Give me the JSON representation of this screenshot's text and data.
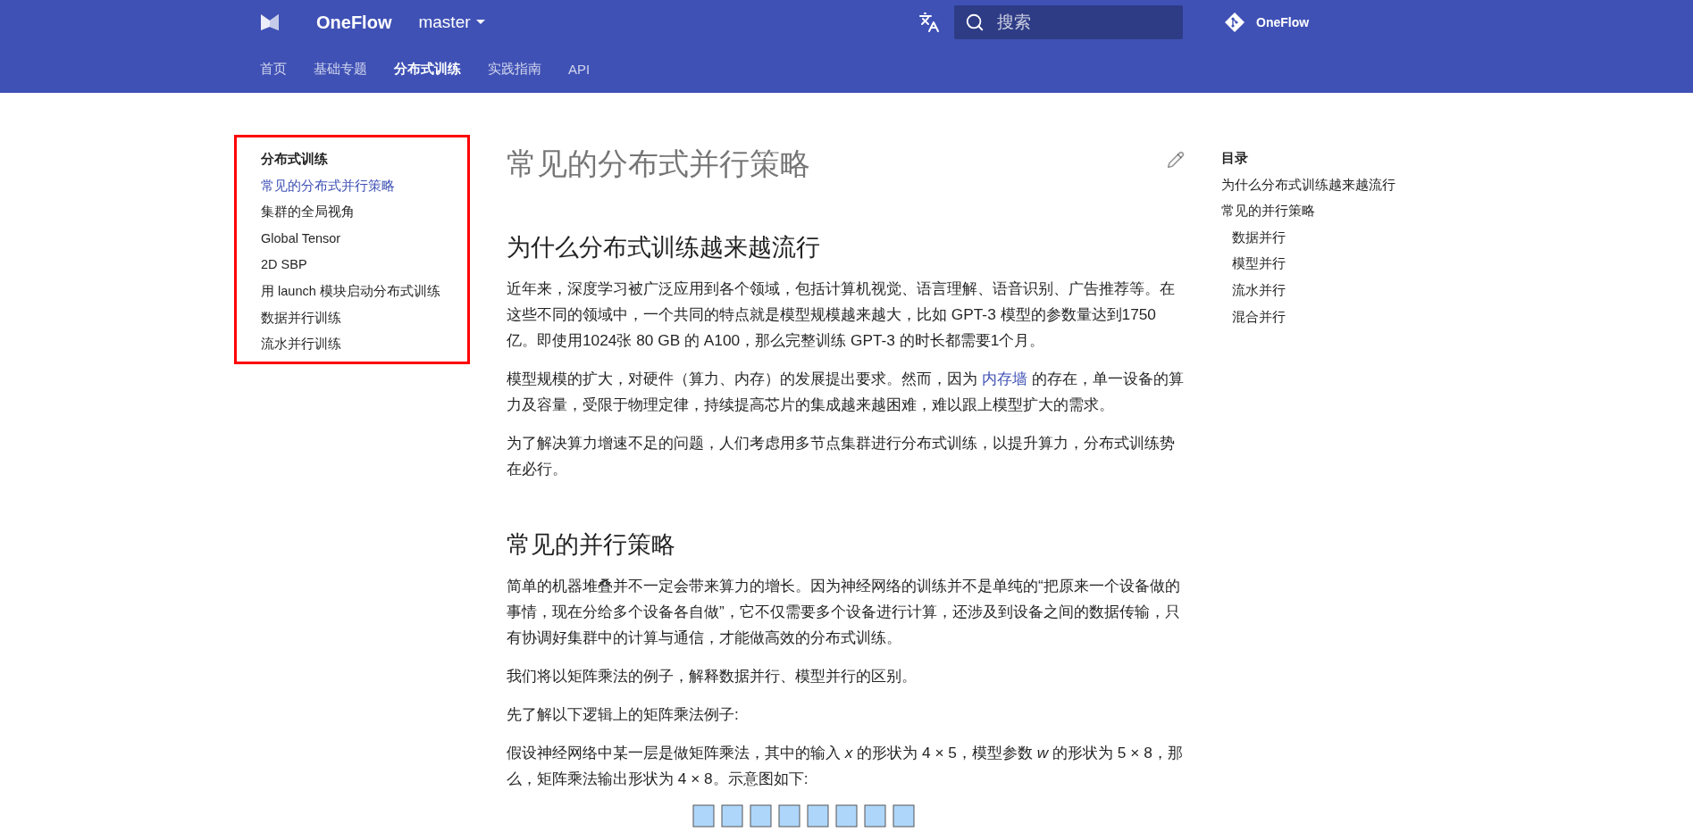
{
  "header": {
    "brand": "OneFlow",
    "version": "master",
    "search": {
      "placeholder": "搜索"
    },
    "repo": "OneFlow"
  },
  "tabs": [
    {
      "label": "首页",
      "selected": false
    },
    {
      "label": "基础专题",
      "selected": false
    },
    {
      "label": "分布式训练",
      "selected": true
    },
    {
      "label": "实践指南",
      "selected": false
    },
    {
      "label": "API",
      "selected": false
    }
  ],
  "sidebar": {
    "title": "分布式训练",
    "highlighted": true,
    "items": [
      {
        "label": "常见的分布式并行策略",
        "selected": true
      },
      {
        "label": "集群的全局视角",
        "selected": false
      },
      {
        "label": "Global Tensor",
        "selected": false
      },
      {
        "label": "2D SBP",
        "selected": false
      },
      {
        "label": "用 launch 模块启动分布式训练",
        "selected": false
      },
      {
        "label": "数据并行训练",
        "selected": false
      },
      {
        "label": "流水并行训练",
        "selected": false
      }
    ]
  },
  "article": {
    "title": "常见的分布式并行策略",
    "blocks": [
      {
        "kind": "heading",
        "text": "为什么分布式训练越来越流行"
      },
      {
        "kind": "paragraph",
        "parts": [
          {
            "kind": "text",
            "text": "近年来，深度学习被广泛应用到各个领域，包括计算机视觉、语言理解、语音识别、广告推荐等。在这些不同的领域中，一个共同的特点就是模型规模越来越大，比如 GPT-3 模型的参数量达到1750亿。即使用1024张 80 GB 的 A100，那么完整训练 GPT-3 的时长都需要1个月。"
          }
        ]
      },
      {
        "kind": "paragraph",
        "parts": [
          {
            "kind": "text",
            "text": "模型规模的扩大，对硬件（算力、内存）的发展提出要求。然而，因为 "
          },
          {
            "kind": "link",
            "text": "内存墙"
          },
          {
            "kind": "text",
            "text": " 的存在，单一设备的算力及容量，受限于物理定律，持续提高芯片的集成越来越困难，难以跟上模型扩大的需求。"
          }
        ]
      },
      {
        "kind": "paragraph",
        "parts": [
          {
            "kind": "text",
            "text": "为了解决算力增速不足的问题，人们考虑用多节点集群进行分布式训练，以提升算力，分布式训练势在必行。"
          }
        ]
      },
      {
        "kind": "heading",
        "text": "常见的并行策略"
      },
      {
        "kind": "paragraph",
        "parts": [
          {
            "kind": "text",
            "text": "简单的机器堆叠并不一定会带来算力的增长。因为神经网络的训练并不是单纯的“把原来一个设备做的事情，现在分给多个设备各自做”，它不仅需要多个设备进行计算，还涉及到设备之间的数据传输，只有协调好集群中的计算与通信，才能做高效的分布式训练。"
          }
        ]
      },
      {
        "kind": "paragraph",
        "parts": [
          {
            "kind": "text",
            "text": "我们将以矩阵乘法的例子，解释数据并行、模型并行的区别。"
          }
        ]
      },
      {
        "kind": "paragraph",
        "parts": [
          {
            "kind": "text",
            "text": "先了解以下逻辑上的矩阵乘法例子:"
          }
        ]
      },
      {
        "kind": "paragraph",
        "parts": [
          {
            "kind": "text",
            "text": "假设神经网络中某一层是做矩阵乘法，其中的输入 *x* 的形状为 4 × 5，模型参数 *w* 的形状为 5 × 8，那么，矩阵乘法输出形状为 4 × 8。示意图如下:"
          }
        ]
      },
      {
        "kind": "figure"
      }
    ]
  },
  "toc": {
    "title": "目录",
    "items": [
      {
        "label": "为什么分布式训练越来越流行"
      },
      {
        "label": "常见的并行策略",
        "children": [
          {
            "label": "数据并行"
          },
          {
            "label": "模型并行"
          },
          {
            "label": "流水并行"
          },
          {
            "label": "混合并行"
          }
        ]
      }
    ]
  }
}
